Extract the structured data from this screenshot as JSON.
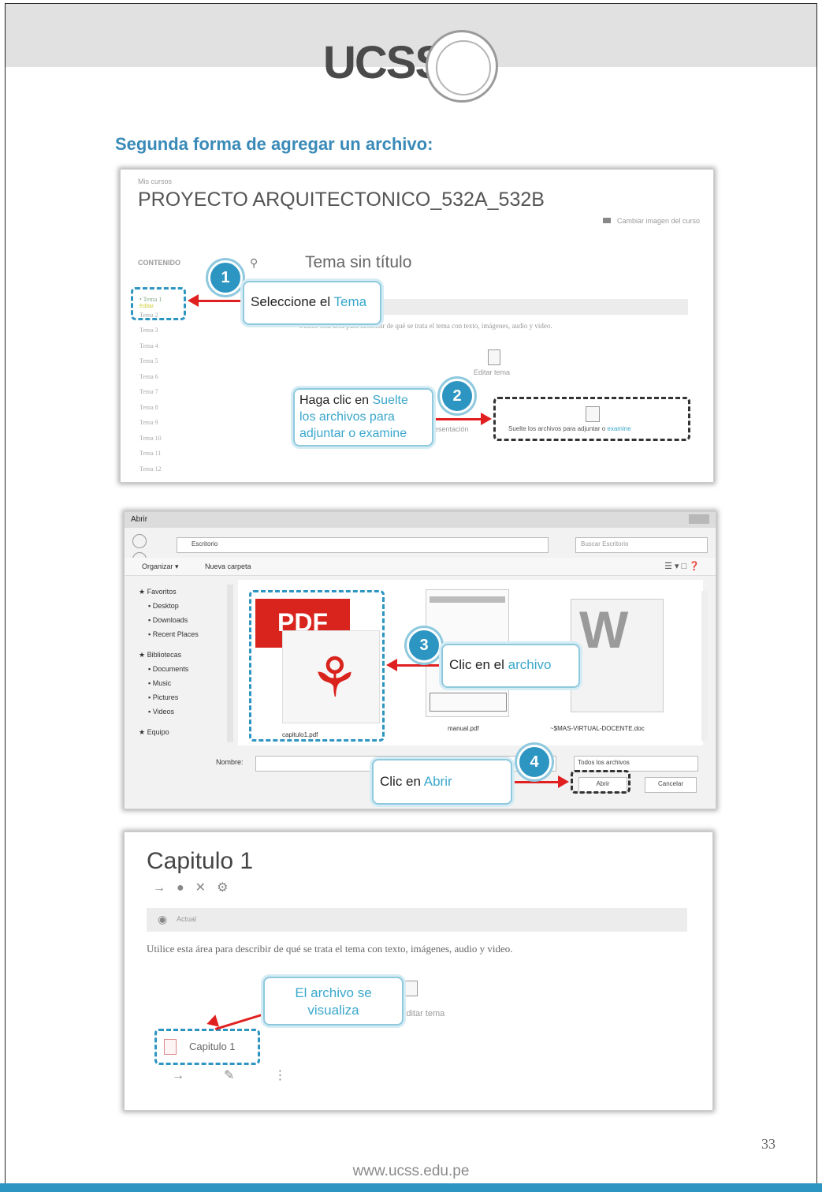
{
  "header": {
    "logo_text": "UCSS"
  },
  "section_title": "Segunda forma de agregar un archivo:",
  "shot1": {
    "breadcrumb": "Mis cursos",
    "course_title": "PROYECTO ARQUITECTONICO_532A_532B",
    "top_right_link": "Cambiar imagen del curso",
    "contents_label": "CONTENIDO",
    "topic_title": "Tema sin título",
    "topic_list": [
      "Tema 1",
      "Tema 2",
      "Tema 3",
      "Tema 4",
      "Tema 5",
      "Tema 6",
      "Tema 7",
      "Tema 8",
      "Tema 9",
      "Tema 10",
      "Tema 11",
      "Tema 12"
    ],
    "topic_sub": "Editar",
    "description": "Utilice esta área para describir de qué se trata el tema con texto, imágenes, audio y video.",
    "edit_label": "Editar tema",
    "drop_zone_text": "Suelte los archivos para adjuntar o ",
    "drop_zone_link": "examine",
    "drop_left_text": "presentación"
  },
  "callout1": {
    "number": "1",
    "text": "Seleccione el ",
    "highlight": "Tema"
  },
  "callout2": {
    "number": "2",
    "text": "Haga clic en ",
    "highlight": "Suelte los archivos para adjuntar o examine"
  },
  "shot2": {
    "window_title": "Abrir",
    "path": "Escritorio",
    "search_placeholder": "Buscar Escritorio",
    "toolbar_organize": "Organizar ▾",
    "toolbar_new_folder": "Nueva carpeta",
    "nav_groups": [
      {
        "header": "Favoritos",
        "items": [
          "Desktop",
          "Downloads",
          "Recent Places"
        ]
      },
      {
        "header": "Bibliotecas",
        "items": [
          "Documents",
          "Music",
          "Pictures",
          "Videos"
        ]
      },
      {
        "header": "Equipo",
        "items": []
      }
    ],
    "files": [
      {
        "name": "capitulo1.pdf",
        "icon": "pdf-icon"
      },
      {
        "name": "manual.pdf",
        "icon": "document-thumbnail"
      },
      {
        "name": "~$MAS-VIRTUAL-DOCENTE.doc",
        "icon": "word-icon"
      }
    ],
    "pdf_badge": "PDF",
    "filename_label": "Nombre:",
    "filter_value": "Todos los archivos",
    "open_button": "Abrir",
    "cancel_button": "Cancelar"
  },
  "callout3": {
    "number": "3",
    "text": "Clic en el ",
    "highlight": "archivo"
  },
  "callout4": {
    "number": "4",
    "text": "Clic en ",
    "highlight": "Abrir"
  },
  "shot3": {
    "chapter_title": "Capitulo 1",
    "hidden_label": "Actual",
    "description": "Utilice esta área para describir de qué se trata el tema con texto, imágenes, audio y video.",
    "edit_label": "Editar tema",
    "file_item": "Capitulo 1"
  },
  "callout5": {
    "text": "El archivo se visualiza"
  },
  "footer": {
    "page_number": "33",
    "url": "www.ucss.edu.pe"
  },
  "colors": {
    "accent": "#2d95c2",
    "arrow": "#e02020",
    "title": "#3a8ab8"
  }
}
